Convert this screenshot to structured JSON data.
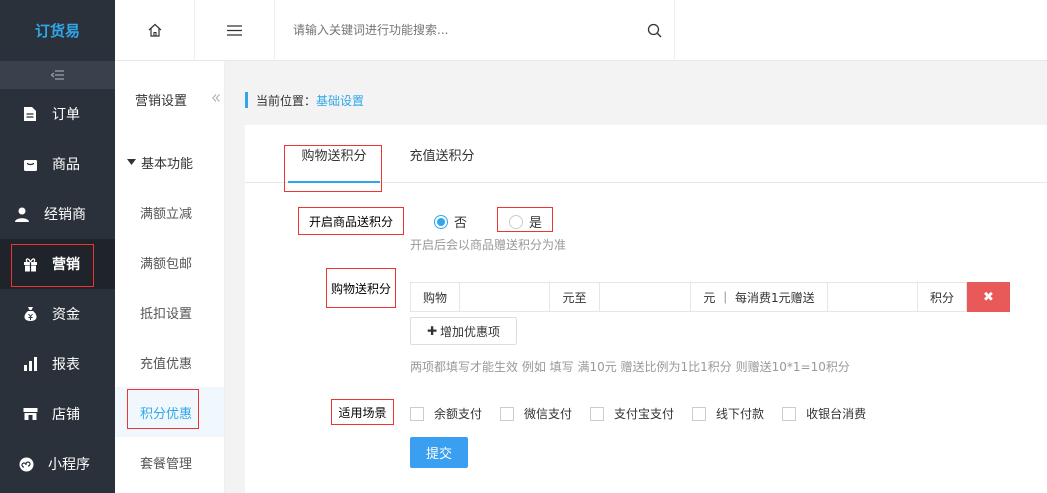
{
  "app": {
    "logo": "订货易"
  },
  "sidebar": {
    "items": [
      {
        "label": "订单",
        "icon": "document-icon"
      },
      {
        "label": "商品",
        "icon": "bag-icon"
      },
      {
        "label": "经销商",
        "icon": "person-icon"
      },
      {
        "label": "营销",
        "icon": "gift-icon"
      },
      {
        "label": "资金",
        "icon": "money-bag-icon"
      },
      {
        "label": "报表",
        "icon": "bar-chart-icon"
      },
      {
        "label": "店铺",
        "icon": "shop-icon"
      },
      {
        "label": "小程序",
        "icon": "mini-program-icon"
      }
    ],
    "active": "营销"
  },
  "header": {
    "search_placeholder": "请输入关键词进行功能搜索..."
  },
  "submenu": {
    "title": "营销设置",
    "group": "基本功能",
    "items": [
      "满额立减",
      "满额包邮",
      "抵扣设置",
      "充值优惠",
      "积分优惠",
      "套餐管理"
    ],
    "active": "积分优惠"
  },
  "breadcrumb": {
    "prefix": "当前位置：",
    "current": "基础设置"
  },
  "tabs": [
    "购物送积分",
    "充值送积分"
  ],
  "form": {
    "enable_label": "开启商品送积分",
    "option_no": "否",
    "option_yes": "是",
    "enable_hint": "开启后会以商品赠送积分为准",
    "rule_label": "购物送积分",
    "rule": {
      "c1": "购物",
      "c3": "元至",
      "c5": "元 ｜ 每消费1元赠送",
      "c7": "积分",
      "delete": "✖"
    },
    "add_button": "增加优惠项",
    "rule_hint": "两项都填写才能生效 例如 填写 满10元 赠送比例为1比1积分 则赠送10*1=10积分",
    "scene_label": "适用场景",
    "scenes": [
      "余额支付",
      "微信支付",
      "支付宝支付",
      "线下付款",
      "收银台消费"
    ],
    "submit": "提交"
  },
  "colors": {
    "accent": "#2fa7ea",
    "sidebar_bg": "#2b313a",
    "danger": "#e85a5a",
    "highlight_box": "#ee3333"
  }
}
